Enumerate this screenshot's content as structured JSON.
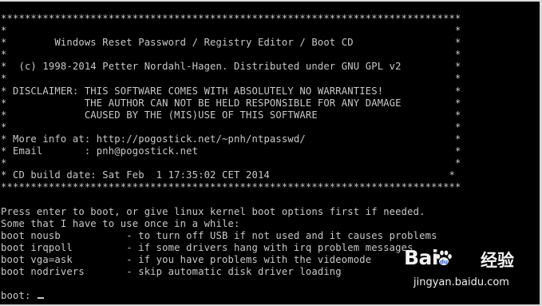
{
  "terminal": {
    "lines": [
      "*****************************************************************************",
      "*                                                                           *",
      "*        Windows Reset Password / Registry Editor / Boot CD                 *",
      "*                                                                           *",
      "*  (c) 1998-2014 Petter Nordahl-Hagen. Distributed under GNU GPL v2         *",
      "*                                                                           *",
      "* DISCLAIMER: THIS SOFTWARE COMES WITH ABSOLUTELY NO WARRANTIES!            *",
      "*             THE AUTHOR CAN NOT BE HELD RESPONSIBLE FOR ANY DAMAGE         *",
      "*             CAUSED BY THE (MIS)USE OF THIS SOFTWARE                       *",
      "*                                                                           *",
      "* More info at: http://pogostick.net/~pnh/ntpasswd/                         *",
      "* Email       : pnh@pogostick.net                                           *",
      "*                                                                           *",
      "* CD build date: Sat Feb  1 17:35:02 CET 2014                              *",
      "*****************************************************************************",
      "",
      "Press enter to boot, or give linux kernel boot options first if needed.",
      "Some that I have to use once in a while:",
      "boot nousb           - to turn off USB if not used and it causes problems",
      "boot irqpoll         - if some drivers hang with irq problem messages",
      "boot vga=ask         - if you have problems with the videomode",
      "boot nodrivers       - skip automatic disk driver loading",
      "",
      "boot: "
    ]
  },
  "watermark": {
    "logo": "Bai",
    "logo_suffix": "",
    "chinese": "经验",
    "url": "jingyan.baidu.com",
    "paw_icon": "paw-icon"
  },
  "colors": {
    "background": "#000000",
    "text": "#c8c8c8"
  }
}
